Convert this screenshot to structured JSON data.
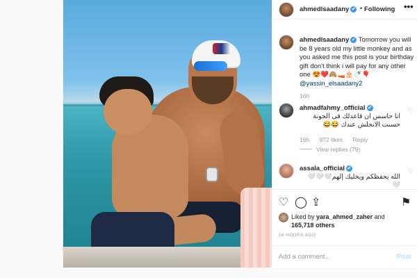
{
  "header": {
    "username": "ahmedlsaadany",
    "verified_mark": "✔",
    "separator": "•",
    "follow_label": "Following",
    "more_label": "•••"
  },
  "caption": {
    "username": "ahmedlsaadany",
    "verified_mark": "✔",
    "text": "Tomorrow you will be 8 years old my little monkey and as you asked me this post is your birthday gift don't think i will pay for any other one 😍❤️🙈🚤🎂🍼🎈",
    "mention": "@yassin_elsaadany2",
    "time": "16h"
  },
  "comments": [
    {
      "username": "ahmadfahmy_official",
      "verified_mark": "✔",
      "text": "انا حاسس ان قاعدلك فى الجونة حسنت الانجلش عندك 😂😂",
      "time": "16h",
      "likes": "972 likes",
      "reply_label": "Reply",
      "view_replies": "View replies (79)",
      "heart": "♡"
    },
    {
      "username": "assala_official",
      "verified_mark": "✔",
      "text": "الله يحفظكم ويخليك إلهم🤍🤍🤍🤍",
      "heart": "♡"
    }
  ],
  "actions": {
    "heart": "♡",
    "comment": "◯",
    "share": "⇪",
    "save": "⚑"
  },
  "likes": {
    "prefix": "Liked by",
    "user": "yara_ahmed_zaher",
    "and": "and",
    "others": "165,718 others"
  },
  "timestamp": "16 HOURS AGO",
  "add_comment": {
    "placeholder": "Add a comment...",
    "post_label": "Post"
  }
}
